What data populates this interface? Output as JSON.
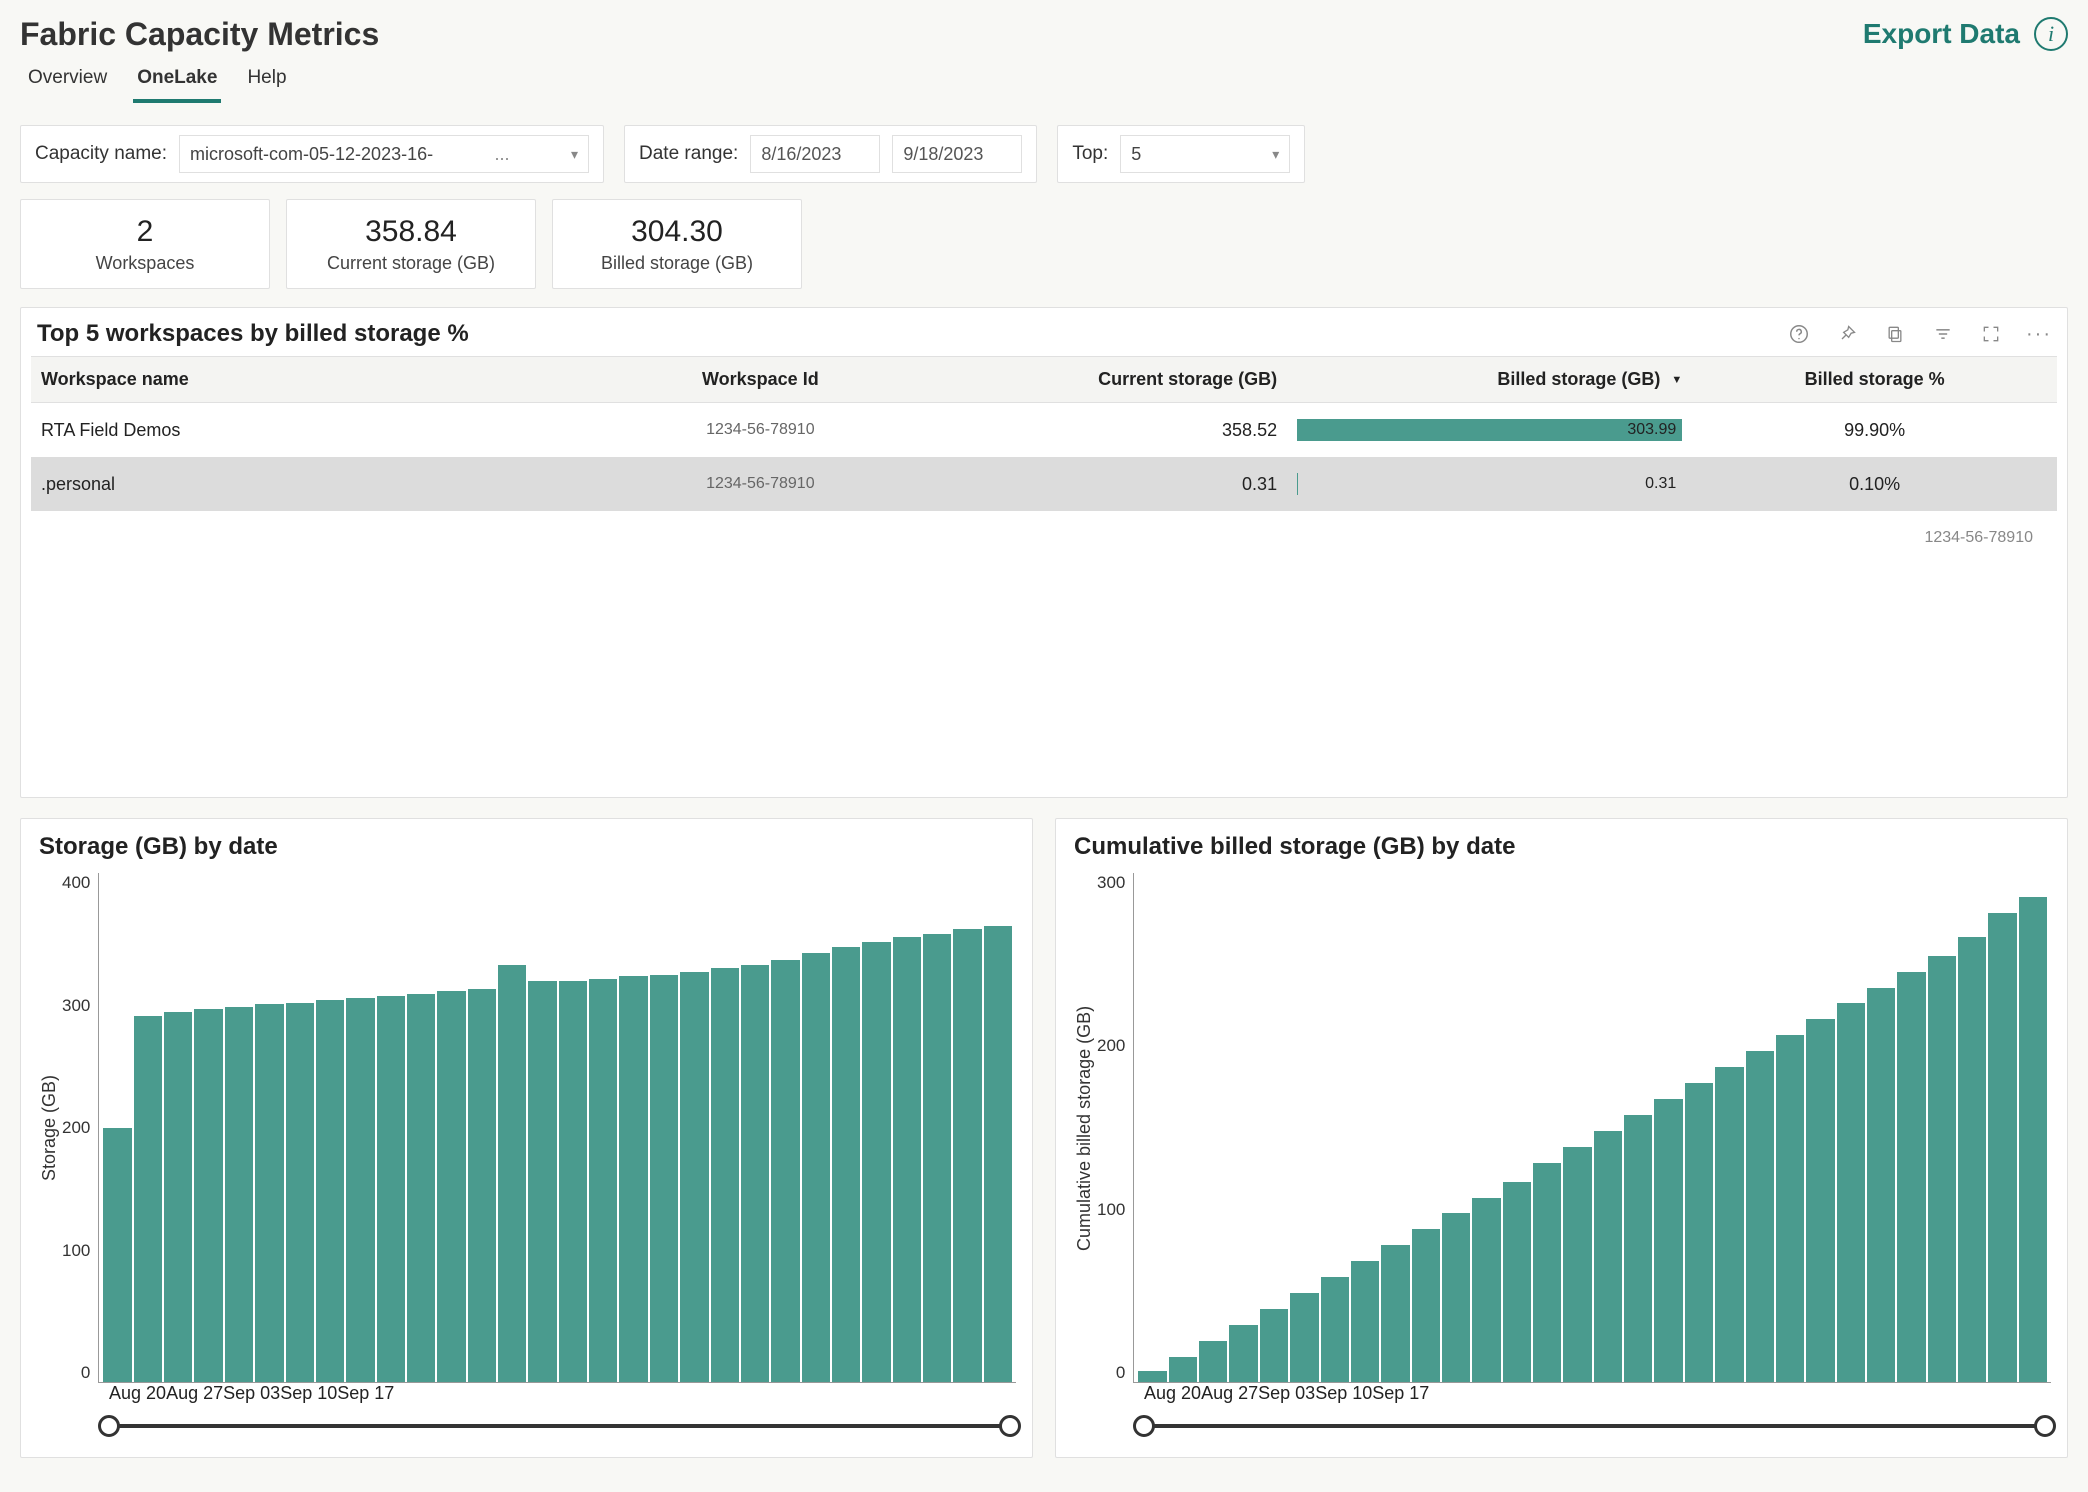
{
  "header": {
    "title": "Fabric Capacity Metrics",
    "export_label": "Export Data"
  },
  "tabs": [
    {
      "label": "Overview",
      "active": false
    },
    {
      "label": "OneLake",
      "active": true
    },
    {
      "label": "Help",
      "active": false
    }
  ],
  "filters": {
    "capacity_label": "Capacity name:",
    "capacity_value": "microsoft-com-05-12-2023-16-",
    "date_label": "Date range:",
    "date_start": "8/16/2023",
    "date_end": "9/18/2023",
    "top_label": "Top:",
    "top_value": "5"
  },
  "kpis": [
    {
      "value": "2",
      "caption": "Workspaces"
    },
    {
      "value": "358.84",
      "caption": "Current storage (GB)"
    },
    {
      "value": "304.30",
      "caption": "Billed storage (GB)"
    }
  ],
  "table": {
    "title": "Top 5 workspaces by billed storage %",
    "columns": {
      "c0": "Workspace name",
      "c1": "Workspace Id",
      "c2": "Current storage (GB)",
      "c3": "Billed storage (GB)",
      "c4": "Billed storage %"
    },
    "rows": [
      {
        "name": "RTA Field Demos",
        "id": "1234-56-78910",
        "current": "358.52",
        "billed": "303.99",
        "billed_pct_num": 99.9,
        "pct": "99.90%"
      },
      {
        "name": ".personal",
        "id": "1234-56-78910",
        "current": "0.31",
        "billed": "0.31",
        "billed_pct_num": 0.1,
        "pct": "0.10%"
      }
    ],
    "footer_note": "1234-56-78910"
  },
  "chart_data": [
    {
      "type": "bar",
      "title": "Storage (GB) by date",
      "ylabel": "Storage (GB)",
      "ylim": [
        0,
        400
      ],
      "yticks": [
        400,
        300,
        200,
        100,
        0
      ],
      "xticks": [
        "Aug 20",
        "Aug 27",
        "Sep 03",
        "Sep 10",
        "Sep 17"
      ],
      "categories": [
        "Aug 20",
        "Aug 21",
        "Aug 22",
        "Aug 23",
        "Aug 24",
        "Aug 25",
        "Aug 26",
        "Aug 27",
        "Aug 28",
        "Aug 29",
        "Aug 30",
        "Aug 31",
        "Sep 01",
        "Sep 02",
        "Sep 03",
        "Sep 04",
        "Sep 05",
        "Sep 06",
        "Sep 07",
        "Sep 08",
        "Sep 09",
        "Sep 10",
        "Sep 11",
        "Sep 12",
        "Sep 13",
        "Sep 14",
        "Sep 15",
        "Sep 16",
        "Sep 17",
        "Sep 18"
      ],
      "values": [
        200,
        288,
        291,
        293,
        295,
        297,
        298,
        300,
        302,
        303,
        305,
        307,
        309,
        328,
        315,
        315,
        317,
        319,
        320,
        322,
        325,
        328,
        332,
        337,
        342,
        346,
        350,
        352,
        356,
        358
      ]
    },
    {
      "type": "bar",
      "title": "Cumulative billed storage (GB) by date",
      "ylabel": "Cumulative billed storage (GB)",
      "ylim": [
        0,
        320
      ],
      "yticks": [
        300,
        200,
        100,
        0
      ],
      "xticks": [
        "Aug 20",
        "Aug 27",
        "Sep 03",
        "Sep 10",
        "Sep 17"
      ],
      "categories": [
        "Aug 20",
        "Aug 21",
        "Aug 22",
        "Aug 23",
        "Aug 24",
        "Aug 25",
        "Aug 26",
        "Aug 27",
        "Aug 28",
        "Aug 29",
        "Aug 30",
        "Aug 31",
        "Sep 01",
        "Sep 02",
        "Sep 03",
        "Sep 04",
        "Sep 05",
        "Sep 06",
        "Sep 07",
        "Sep 08",
        "Sep 09",
        "Sep 10",
        "Sep 11",
        "Sep 12",
        "Sep 13",
        "Sep 14",
        "Sep 15",
        "Sep 16",
        "Sep 17",
        "Sep 18"
      ],
      "values": [
        7,
        16,
        26,
        36,
        46,
        56,
        66,
        76,
        86,
        96,
        106,
        116,
        126,
        138,
        148,
        158,
        168,
        178,
        188,
        198,
        208,
        218,
        228,
        238,
        248,
        258,
        268,
        280,
        295,
        305
      ]
    }
  ]
}
